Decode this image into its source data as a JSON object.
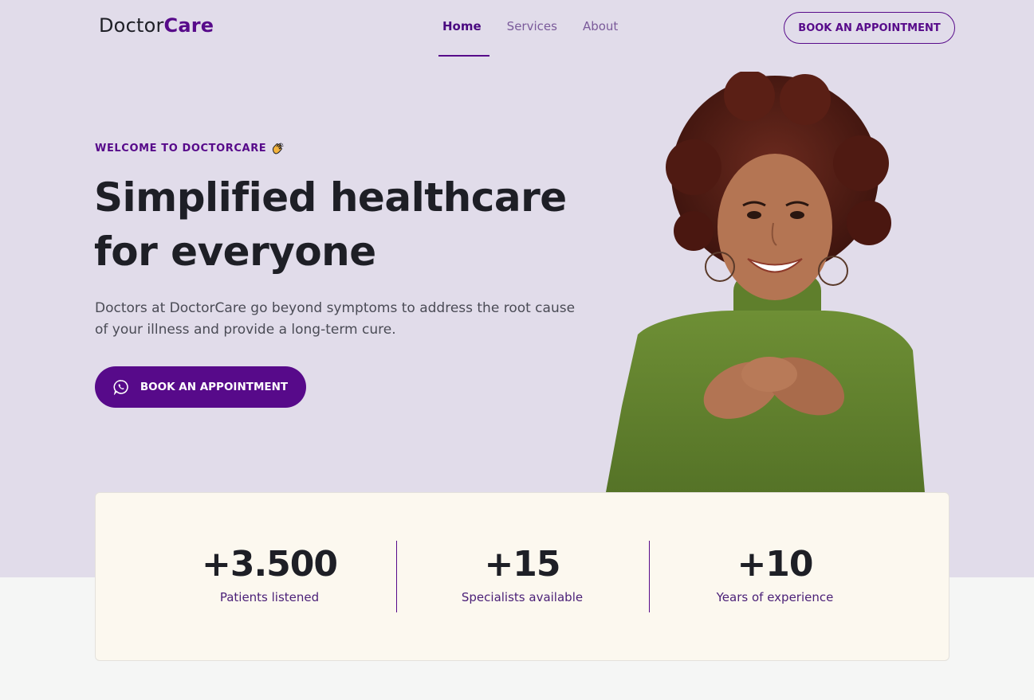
{
  "header": {
    "logo_part1": "Doctor",
    "logo_part2": "Care",
    "nav": [
      "Home",
      "Services",
      "About"
    ],
    "book_button": "BOOK AN APPOINTMENT"
  },
  "hero": {
    "eyebrow": "WELCOME TO DOCTORCARE",
    "eyebrow_icon": "clapping-hands-icon",
    "headline_line1": "Simplified healthcare",
    "headline_line2": "for everyone",
    "lead": "Doctors at DoctorCare go beyond symptoms to address the root cause of your illness and provide a long-term cure.",
    "cta_label": "BOOK AN APPOINTMENT",
    "cta_icon": "whatsapp-icon"
  },
  "stats": [
    {
      "value": "+3.500",
      "label": "Patients listened"
    },
    {
      "value": "+15",
      "label": "Specialists available"
    },
    {
      "value": "+10",
      "label": "Years of experience"
    }
  ],
  "colors": {
    "brand": "#570a8a",
    "hero_bg": "#e1dcea",
    "card_bg": "#fcf8ef",
    "text_dark": "#1e1f26"
  }
}
